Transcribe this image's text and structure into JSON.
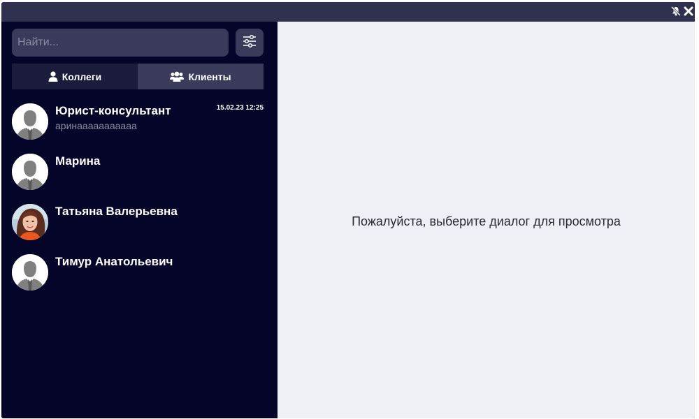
{
  "titlebar": {
    "icons": [
      "bell-off-icon",
      "close-icon"
    ]
  },
  "sidebar": {
    "search": {
      "placeholder": "Найти...",
      "value": ""
    },
    "filter_icon": "sliders-icon",
    "tabs": [
      {
        "label": "Коллеги",
        "icon": "user-icon",
        "active": true
      },
      {
        "label": "Клиенты",
        "icon": "users-icon",
        "active": false
      }
    ],
    "contacts": [
      {
        "name": "Юрист-консультант",
        "preview": "аринааааааааааа",
        "time": "15.02.23 12:25",
        "avatar": "default-avatar-icon"
      },
      {
        "name": "Марина",
        "preview": "",
        "time": "",
        "avatar": "default-avatar-icon"
      },
      {
        "name": "Татьяна Валерьевна",
        "preview": "",
        "time": "",
        "avatar": "photo-avatar"
      },
      {
        "name": "Тимур Анатольевич",
        "preview": "",
        "time": "",
        "avatar": "default-avatar-icon"
      }
    ]
  },
  "main": {
    "placeholder": "Пожалуйста, выберите диалог для просмотра"
  },
  "colors": {
    "sidebar_bg": "#05052a",
    "titlebar_bg": "#30314f",
    "control_bg": "#3a3b5a",
    "main_bg": "#edf0f5",
    "active_tab_bg": "#1b1c3b"
  }
}
